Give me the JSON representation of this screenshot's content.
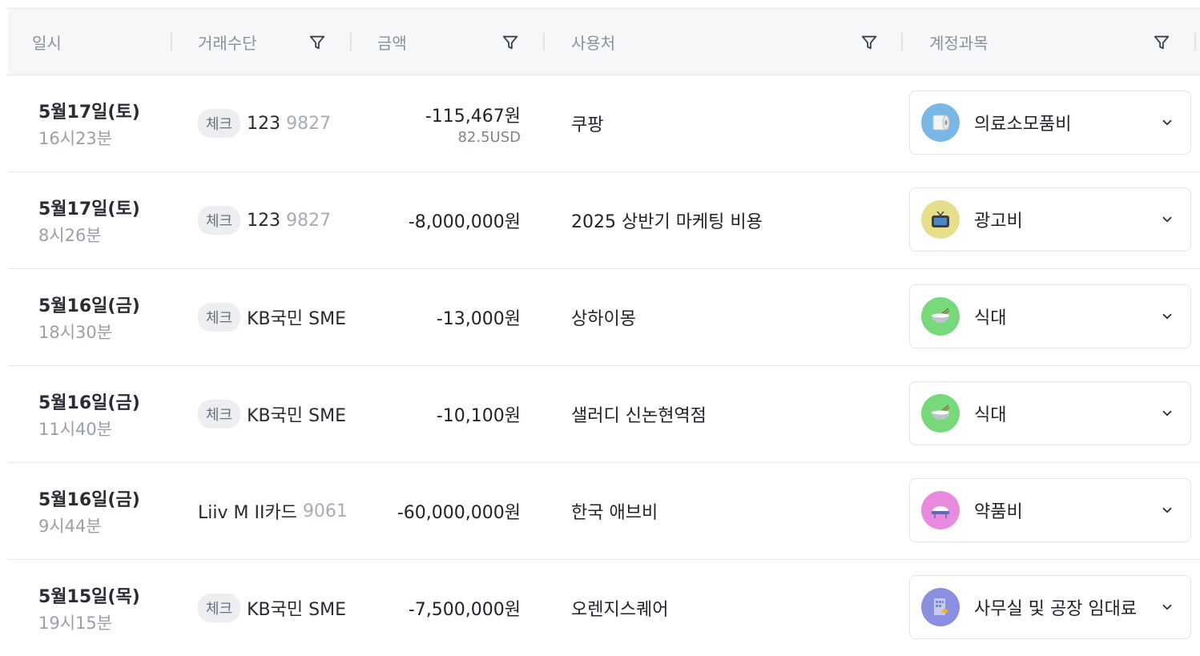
{
  "header": {
    "date": "일시",
    "method": "거래수단",
    "amount": "금액",
    "merchant": "사용처",
    "account": "계정과목"
  },
  "rows": [
    {
      "date": "5월17일(토)",
      "time": "16시23분",
      "badge": "체크",
      "method_name": "123",
      "method_number": "9827",
      "amount": "-115,467원",
      "amount_sub": "82.5USD",
      "merchant": "쿠팡",
      "account": "의료소모품비",
      "icon": "toilet-paper-icon",
      "icon_bg": "#79b7e6"
    },
    {
      "date": "5월17일(토)",
      "time": "8시26분",
      "badge": "체크",
      "method_name": "123",
      "method_number": "9827",
      "amount": "-8,000,000원",
      "amount_sub": "",
      "merchant": "2025 상반기 마케팅 비용",
      "account": "광고비",
      "icon": "television-icon",
      "icon_bg": "#e7de8c"
    },
    {
      "date": "5월16일(금)",
      "time": "18시30분",
      "badge": "체크",
      "method_name": "KB국민 SME",
      "method_number": "",
      "amount": "-13,000원",
      "amount_sub": "",
      "merchant": "상하이몽",
      "account": "식대",
      "icon": "rice-bowl-icon",
      "icon_bg": "#78d97a"
    },
    {
      "date": "5월16일(금)",
      "time": "11시40분",
      "badge": "체크",
      "method_name": "KB국민 SME",
      "method_number": "",
      "amount": "-10,100원",
      "amount_sub": "",
      "merchant": "샐러디 신논현역점",
      "account": "식대",
      "icon": "rice-bowl-icon",
      "icon_bg": "#78d97a"
    },
    {
      "date": "5월16일(금)",
      "time": "9시44분",
      "badge": "",
      "method_name": "Liiv M II카드",
      "method_number": "9061",
      "amount": "-60,000,000원",
      "amount_sub": "",
      "merchant": "한국 애브비",
      "account": "약품비",
      "icon": "pill-icon",
      "icon_bg": "#e88bde"
    },
    {
      "date": "5월15일(목)",
      "time": "19시15분",
      "badge": "체크",
      "method_name": "KB국민 SME",
      "method_number": "",
      "amount": "-7,500,000원",
      "amount_sub": "",
      "merchant": "오렌지스퀘어",
      "account": "사무실 및 공장 임대료",
      "icon": "office-building-icon",
      "icon_bg": "#8a8fe0"
    }
  ]
}
